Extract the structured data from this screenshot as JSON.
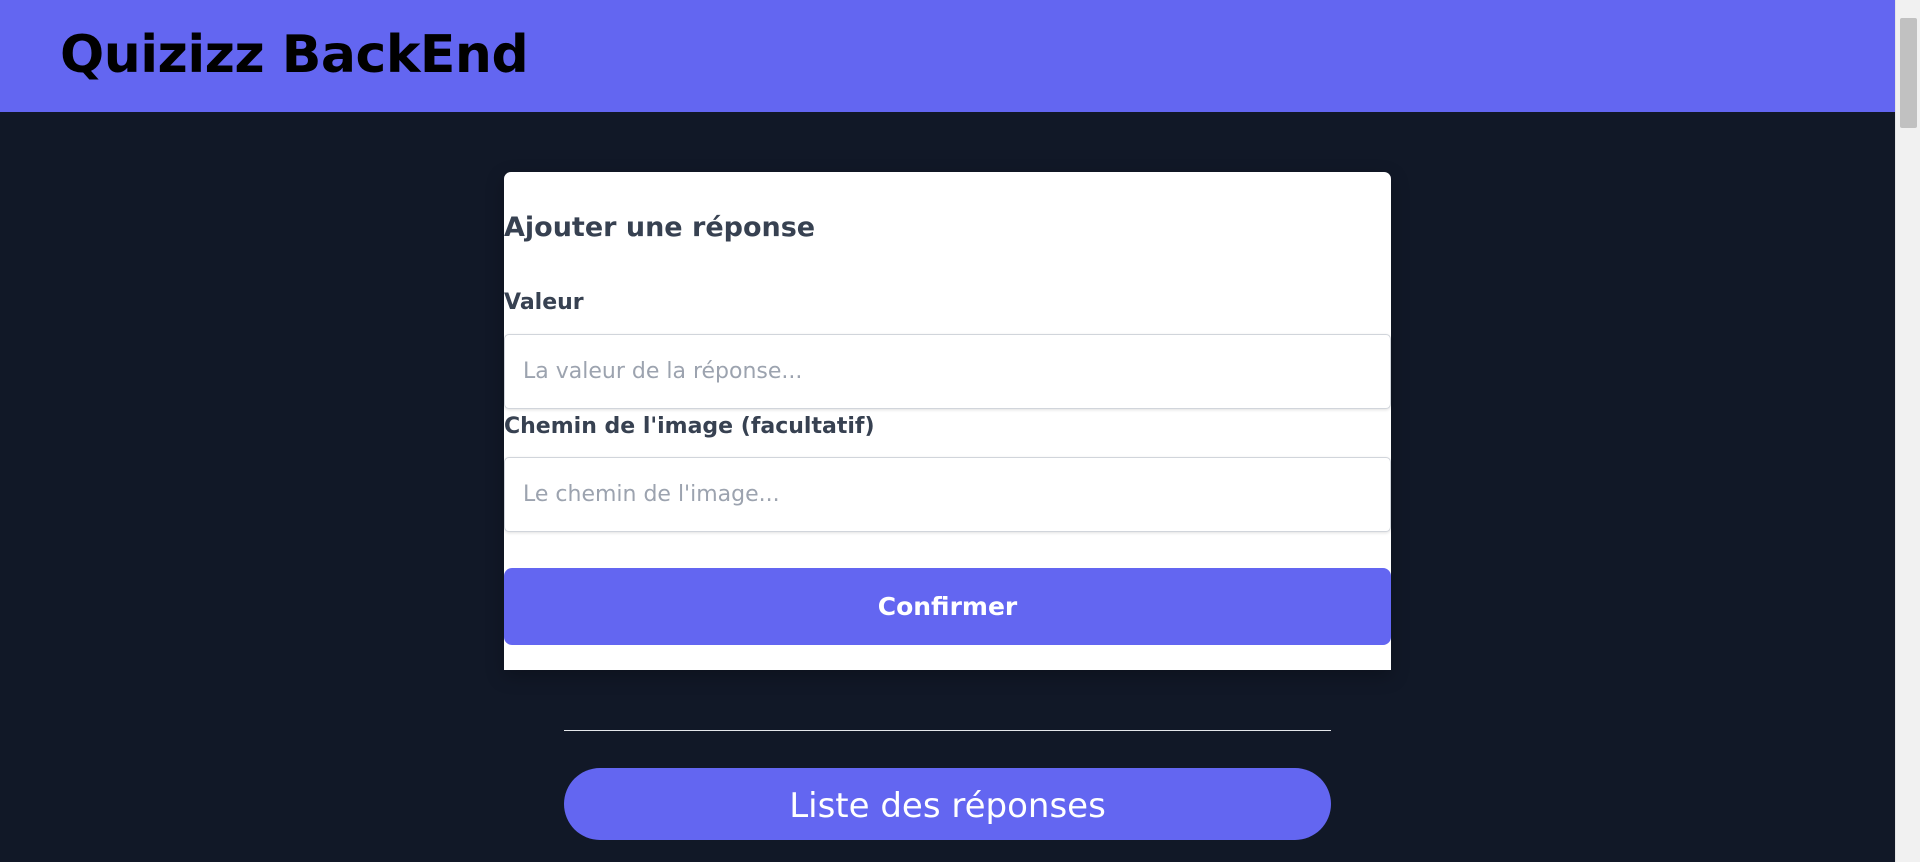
{
  "header": {
    "title": "Quizizz BackEnd"
  },
  "form": {
    "title": "Ajouter une réponse",
    "valeur_label": "Valeur",
    "valeur_placeholder": "La valeur de la réponse...",
    "valeur_value": "",
    "chemin_label": "Chemin de l'image (facultatif)",
    "chemin_placeholder": "Le chemin de l'image...",
    "chemin_value": "",
    "confirm_label": "Confirmer"
  },
  "list": {
    "button_label": "Liste des réponses"
  },
  "colors": {
    "accent": "#6366f1",
    "background": "#111827",
    "card": "#ffffff",
    "label_text": "#374151",
    "placeholder": "#9ca3af"
  }
}
